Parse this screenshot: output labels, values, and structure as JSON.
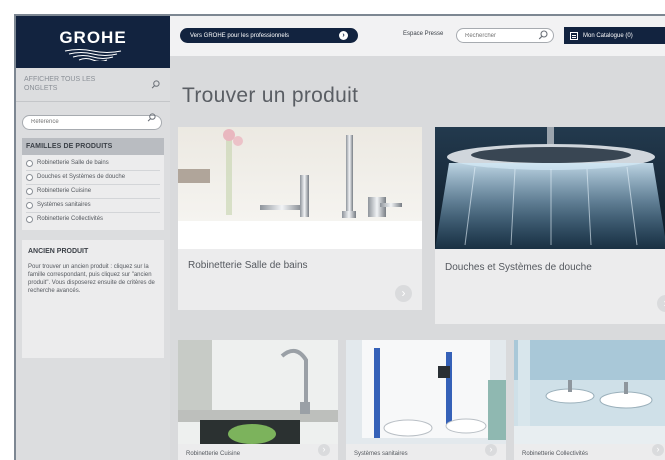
{
  "brand": {
    "name": "GROHE"
  },
  "sidebar": {
    "show_all": "AFFICHER TOUS LES ONGLETS",
    "reference_placeholder": "Référence",
    "families_title": "FAMILLES DE PRODUITS",
    "families": [
      "Robinetterie Salle de bains",
      "Douches et Systèmes de douche",
      "Robinetterie Cuisine",
      "Systèmes sanitaires",
      "Robinetterie Collectivités"
    ],
    "old_product_title": "ANCIEN PRODUIT",
    "old_product_text": "Pour trouver un ancien produit : cliquez sur la famille correspondant, puis cliquez sur \"ancien produit\". Vous disposerez ensuite de critères de recherche avancés."
  },
  "topbar": {
    "pro_button": "Vers GROHE pour les professionnels",
    "press_link": "Espace Presse",
    "search_placeholder": "Rechercher",
    "catalog_button": "Mon Catalogue (0)"
  },
  "main": {
    "title": "Trouver un produit",
    "cards": [
      {
        "label": "Robinetterie Salle de bains"
      },
      {
        "label": "Douches et Systèmes de douche"
      },
      {
        "label": "Robinetterie Cuisine"
      },
      {
        "label": "Systèmes sanitaires"
      },
      {
        "label": "Robinetterie Collectivités"
      }
    ]
  },
  "icons": {
    "search": "search-icon",
    "arrow": "arrow-right-icon",
    "chevron": "chevron-right-icon",
    "catalog": "catalog-icon"
  },
  "colors": {
    "brand_navy": "#12233f",
    "background": "#d9dadc",
    "card": "#ececed"
  }
}
